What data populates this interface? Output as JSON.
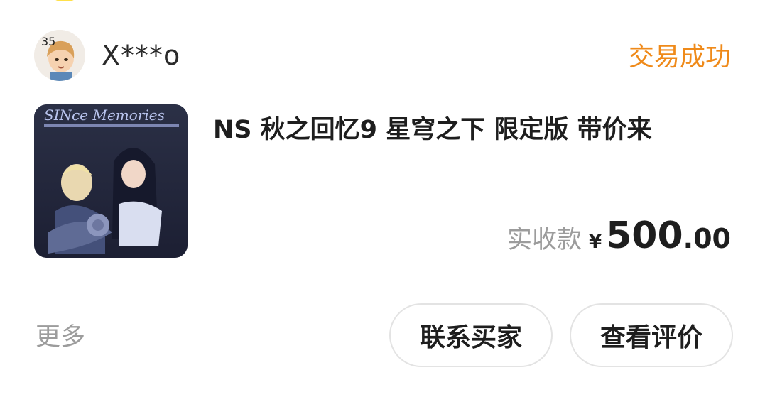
{
  "order": {
    "seller_name": "X***o",
    "avatar_badge": "35",
    "status": "交易成功",
    "product_title": "NS 秋之回忆9 星穹之下 限定版 带价来",
    "product_image_text": "SINce Memories",
    "price": {
      "label": "实收款",
      "currency": "¥",
      "integer": "500",
      "decimal": ".00"
    }
  },
  "actions": {
    "more_label": "更多",
    "contact_buyer_label": "联系买家",
    "view_review_label": "查看评价"
  },
  "colors": {
    "status": "#ef8a1a",
    "muted": "#9c9c9c",
    "text": "#1e1e1e",
    "border": "#e3e3e3"
  }
}
